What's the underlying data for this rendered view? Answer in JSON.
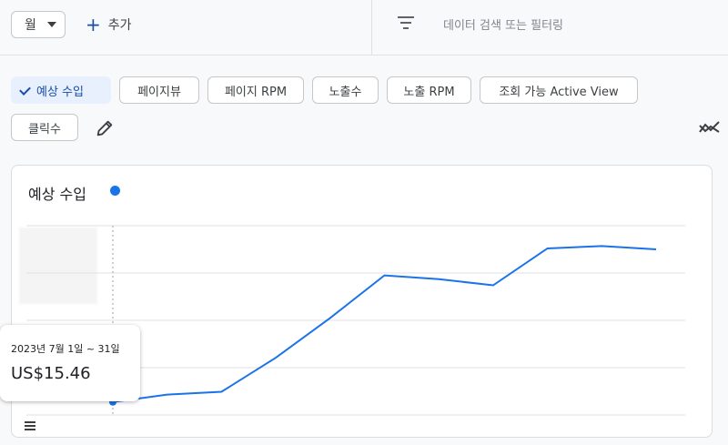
{
  "toolbar": {
    "period_value": "월",
    "add_label": "추가",
    "search_placeholder": "데이터 검색 또는 필터링"
  },
  "metrics": {
    "chips": [
      {
        "label": "예상 수입",
        "selected": true
      },
      {
        "label": "페이지뷰",
        "selected": false
      },
      {
        "label": "페이지 RPM",
        "selected": false
      },
      {
        "label": "노출수",
        "selected": false
      },
      {
        "label": "노출 RPM",
        "selected": false
      },
      {
        "label": "조회 가능 Active View",
        "selected": false
      },
      {
        "label": "클릭수",
        "selected": false
      }
    ]
  },
  "card": {
    "title": "예상 수입"
  },
  "tooltip": {
    "range": "2023년 7월 1일 ~ 31일",
    "value": "US$15.46"
  },
  "colors": {
    "accent": "#1a73e8",
    "selected_chip_bg": "#e8f0fe",
    "selected_chip_text": "#174ea6"
  },
  "chart_data": {
    "type": "line",
    "title": "예상 수입",
    "grid": true,
    "series": [
      {
        "values": [
          15.46,
          18.6,
          19.8,
          34.2,
          51.0,
          69.0,
          67.4,
          64.8,
          80.4,
          81.4,
          80.0
        ]
      }
    ],
    "ylim": [
      10,
      90
    ],
    "highlight_index": 0
  }
}
